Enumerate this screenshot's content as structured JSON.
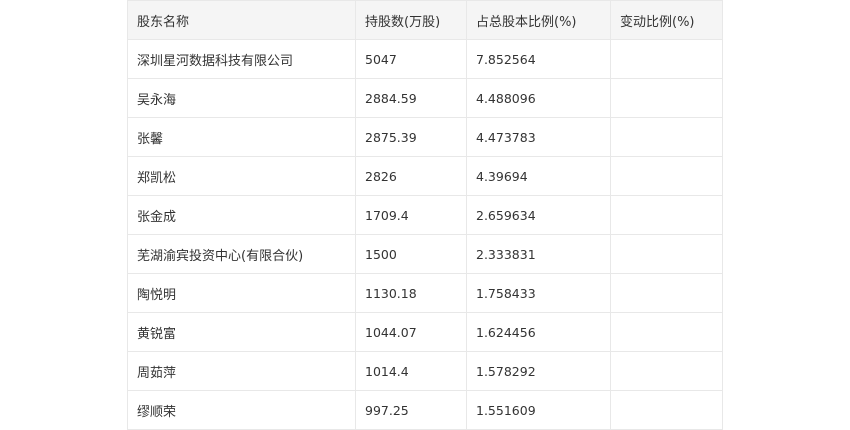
{
  "table": {
    "headers": [
      "股东名称",
      "持股数(万股)",
      "占总股本比例(%)",
      "变动比例(%)"
    ],
    "rows": [
      [
        "深圳星河数据科技有限公司",
        "5047",
        "7.852564",
        ""
      ],
      [
        "吴永海",
        "2884.59",
        "4.488096",
        ""
      ],
      [
        "张馨",
        "2875.39",
        "4.473783",
        ""
      ],
      [
        "郑凯松",
        "2826",
        "4.39694",
        ""
      ],
      [
        "张金成",
        "1709.4",
        "2.659634",
        ""
      ],
      [
        "芜湖渝宾投资中心(有限合伙)",
        "1500",
        "2.333831",
        ""
      ],
      [
        "陶悦明",
        "1130.18",
        "1.758433",
        ""
      ],
      [
        "黄锐富",
        "1044.07",
        "1.624456",
        ""
      ],
      [
        "周茹萍",
        "1014.4",
        "1.578292",
        ""
      ],
      [
        "缪顺荣",
        "997.25",
        "1.551609",
        ""
      ]
    ]
  }
}
